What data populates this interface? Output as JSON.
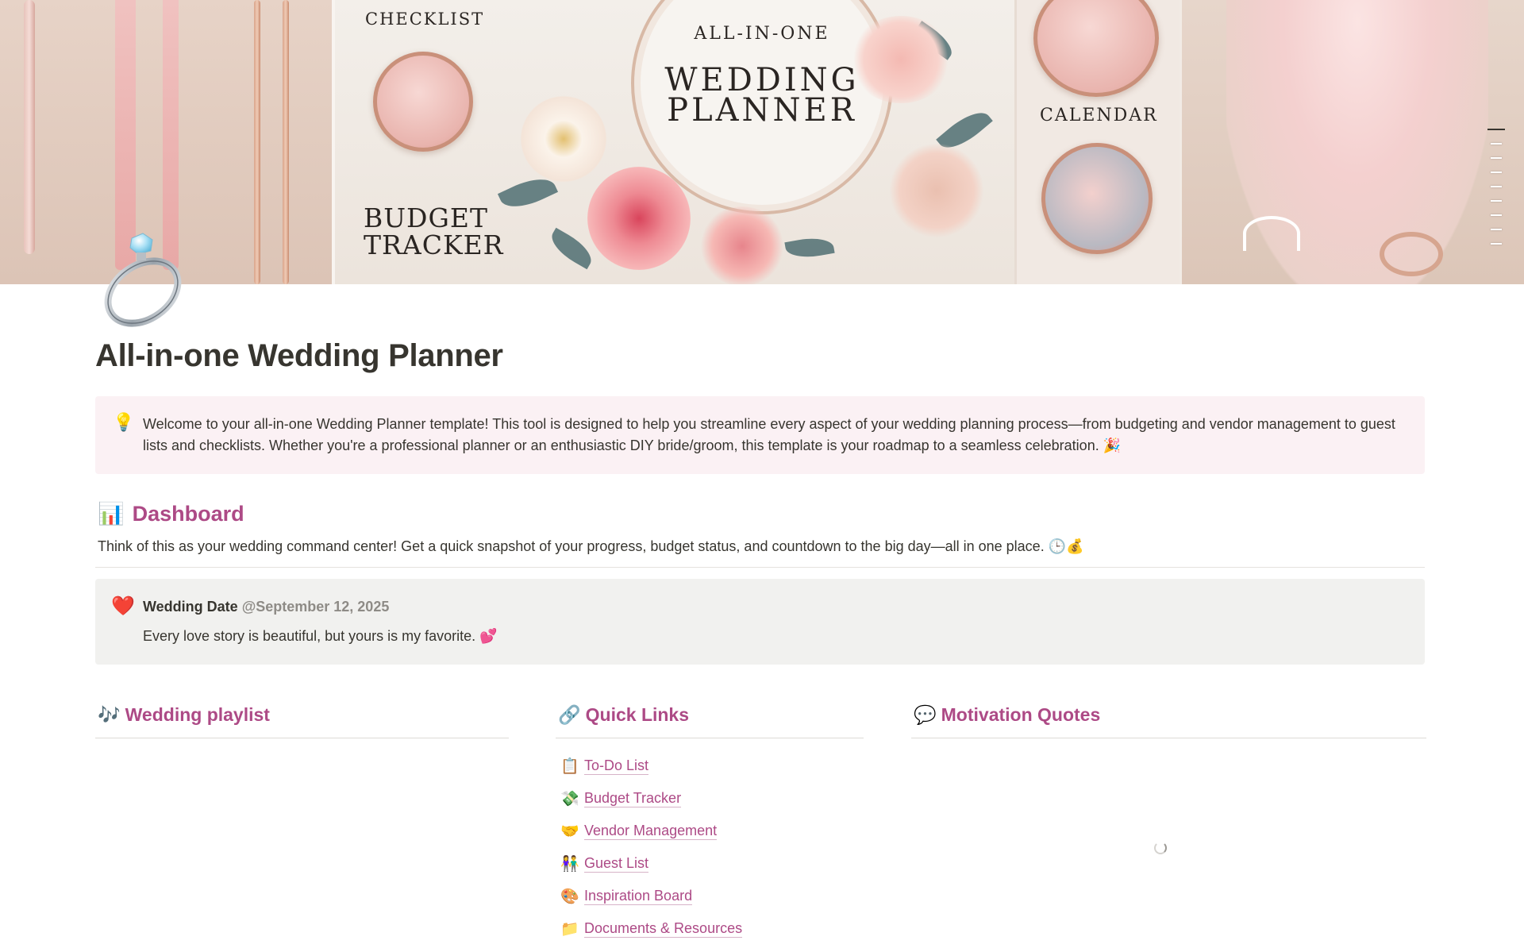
{
  "cover": {
    "checklist_label": "CHECKLIST",
    "budget_label": "BUDGET TRACKER",
    "calendar_label": "CALENDAR",
    "planner_small": "ALL-IN-ONE",
    "planner_big": "WEDDING PLANNER"
  },
  "page": {
    "icon": "ring-icon",
    "title": "All-in-one Wedding Planner"
  },
  "intro_callout": {
    "icon": "💡",
    "text": "Welcome to your all-in-one Wedding Planner template! This tool is designed to help you streamline every aspect of your wedding planning process—from budgeting and vendor management to guest lists and checklists. Whether you're a professional planner or an enthusiastic DIY bride/groom, this template is your roadmap to a seamless celebration. 🎉"
  },
  "dashboard": {
    "icon": "📊",
    "heading": "Dashboard",
    "description": "Think of this as your wedding command center! Get a quick snapshot of your progress, budget status, and countdown to the big day—all in one place. 🕒💰"
  },
  "wedding_callout": {
    "icon": "❤️",
    "label": "Wedding Date",
    "date": "@September 12, 2025",
    "quote": "Every love story is beautiful, but yours is my favorite. 💕"
  },
  "columns": {
    "playlist": {
      "icon": "🎶",
      "heading": "Wedding playlist"
    },
    "quick_links": {
      "icon": "🔗",
      "heading": "Quick Links",
      "items": [
        {
          "icon": "📋",
          "label": "To-Do List"
        },
        {
          "icon": "💸",
          "label": "Budget Tracker"
        },
        {
          "icon": "🤝",
          "label": "Vendor Management"
        },
        {
          "icon": "👫",
          "label": "Guest List"
        },
        {
          "icon": "🎨",
          "label": "Inspiration Board"
        },
        {
          "icon": "📁",
          "label": "Documents & Resources"
        }
      ]
    },
    "quotes": {
      "icon": "💬",
      "heading": "Motivation Quotes"
    }
  },
  "colors": {
    "accent": "#ad4a86",
    "pink_callout": "#fbf1f4",
    "gray_callout": "#f1f1ef",
    "text": "#37352f"
  }
}
